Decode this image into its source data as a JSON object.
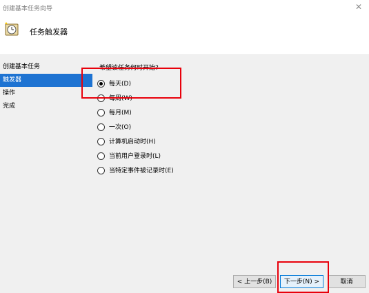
{
  "window": {
    "title": "创建基本任务向导",
    "close_icon": "close-icon"
  },
  "header": {
    "icon": "task-scheduler-icon",
    "title": "任务触发器"
  },
  "nav": {
    "items": [
      {
        "label": "创建基本任务",
        "active": false
      },
      {
        "label": "触发器",
        "active": true
      },
      {
        "label": "操作",
        "active": false
      },
      {
        "label": "完成",
        "active": false
      }
    ]
  },
  "question": "希望该任务何时开始?",
  "options": [
    {
      "label": "每天(D)",
      "checked": true
    },
    {
      "label": "每周(W)",
      "checked": false
    },
    {
      "label": "每月(M)",
      "checked": false
    },
    {
      "label": "一次(O)",
      "checked": false
    },
    {
      "label": "计算机启动时(H)",
      "checked": false
    },
    {
      "label": "当前用户登录时(L)",
      "checked": false
    },
    {
      "label": "当特定事件被记录时(E)",
      "checked": false
    }
  ],
  "buttons": {
    "back": "< 上一步(B)",
    "next": "下一步(N) >",
    "cancel": "取消"
  },
  "colors": {
    "highlight": "#e8000b",
    "nav_active": "#1e73d2",
    "panel_bg": "#f0f0f0"
  }
}
